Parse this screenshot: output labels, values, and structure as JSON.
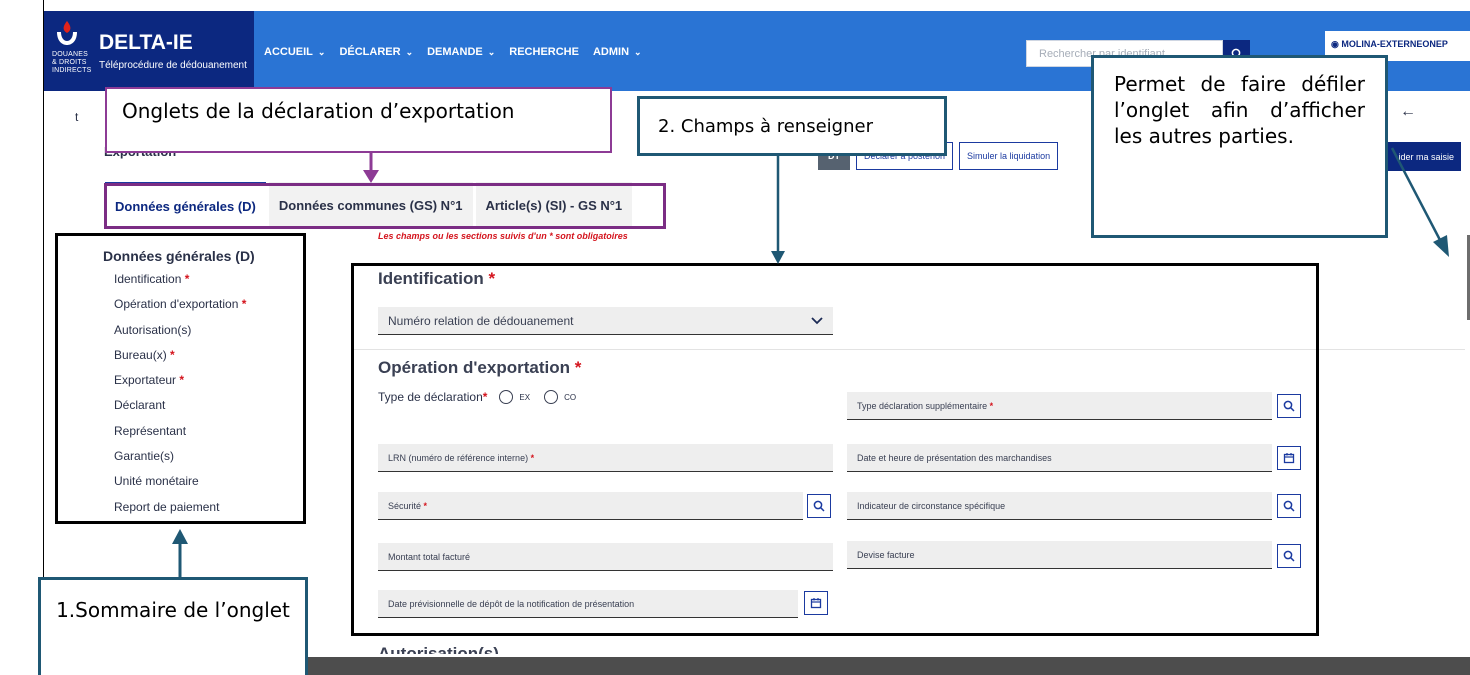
{
  "header": {
    "logo_lines": [
      "DOUANES",
      "& DROITS",
      "INDIRECTS"
    ],
    "brand_name": "DELTA-IE",
    "brand_sub": "Téléprocédure de dédouanement",
    "nav": [
      {
        "label": "ACCUEIL",
        "chevron": true
      },
      {
        "label": "DÉCLARER",
        "chevron": true
      },
      {
        "label": "DEMANDE",
        "chevron": true
      },
      {
        "label": "RECHERCHE",
        "chevron": false
      },
      {
        "label": "ADMIN",
        "chevron": true
      }
    ],
    "search_placeholder": "Rechercher par identifiant",
    "user": "MOLINA-EXTERNEONEP"
  },
  "page": {
    "trail": "t",
    "title": "Exportation",
    "status_badge": "DT",
    "actions": [
      "Déclarer a posteriori",
      "Simuler la liquidation"
    ],
    "validate_button": "ider ma saisie",
    "back_icon": "arrow-left-icon"
  },
  "tabs": [
    {
      "label": "Données générales (D)",
      "active": true
    },
    {
      "label": "Données communes (GS) N°1",
      "active": false
    },
    {
      "label": "Article(s) (SI) - GS N°1",
      "active": false
    }
  ],
  "required_note": "Les champs ou les sections suivis d'un * sont obligatoires",
  "summary": {
    "title": "Données générales (D)",
    "items": [
      {
        "label": "Identification",
        "required": "*"
      },
      {
        "label": "Opération d'exportation",
        "required": "*"
      },
      {
        "label": "Autorisation(s)",
        "required": ""
      },
      {
        "label": "Bureau(x)",
        "required": "*"
      },
      {
        "label": "Exportateur",
        "required": "*"
      },
      {
        "label": "Déclarant",
        "required": ""
      },
      {
        "label": "Représentant",
        "required": ""
      },
      {
        "label": "Garantie(s)",
        "required": ""
      },
      {
        "label": "Unité monétaire",
        "required": ""
      },
      {
        "label": "Report de paiement",
        "required": ""
      }
    ]
  },
  "form": {
    "identification": {
      "title": "Identification",
      "required": "*",
      "select_label": "Numéro relation de dédouanement"
    },
    "operation": {
      "title": "Opération d'exportation",
      "required": "*",
      "type_label": "Type de déclaration",
      "type_required": "*",
      "radio_options": [
        "EX",
        "CO"
      ],
      "fields": {
        "type_supp": "Type déclaration supplémentaire",
        "lrn": "LRN (numéro de référence interne)",
        "date_presentation": "Date et heure de présentation des marchandises",
        "securite": "Sécurité",
        "indicateur": "Indicateur de circonstance spécifique",
        "montant": "Montant total facturé",
        "devise": "Devise facture",
        "date_prev": "Date prévisionnelle de dépôt de la notification de présentation"
      }
    },
    "next_section": "Autorisation(s)"
  },
  "callouts": {
    "onglets": "Onglets de la déclaration d’exportation",
    "champs": "2. Champs à renseigner",
    "permet": "Permet de faire défiler l’onglet afin d’afficher les autres parties.",
    "sommaire": "1.Sommaire de l’onglet"
  },
  "colors": {
    "header_blue": "#2a74d4",
    "navy": "#0c2880",
    "required_red": "#d4141d",
    "callout_purple": "#8d3b95",
    "callout_teal": "#1f5874"
  }
}
